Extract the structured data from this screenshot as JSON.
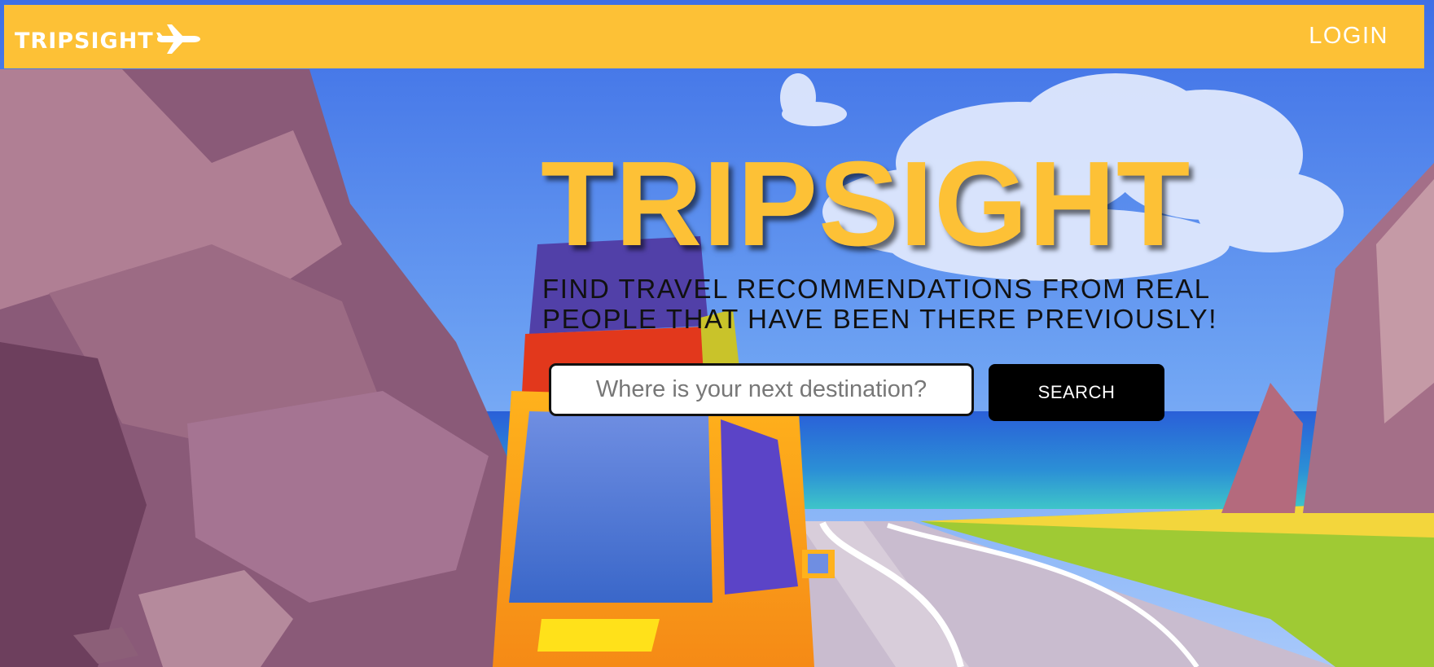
{
  "navbar": {
    "brand": "TRIPSIGHT",
    "brand_icon": "airplane-icon",
    "login_label": "LOGIN"
  },
  "hero": {
    "title": "TRIPSIGHT",
    "tagline_line1": "FIND TRAVEL RECOMMENDATIONS FROM REAL",
    "tagline_line2": "PEOPLE THAT HAVE BEEN THERE PREVIOUSLY!"
  },
  "search": {
    "placeholder": "Where is your next destination?",
    "value": "",
    "button_label": "SEARCH"
  },
  "colors": {
    "accent": "#fdc136",
    "button": "#000000",
    "sky": "#4f86e8"
  }
}
